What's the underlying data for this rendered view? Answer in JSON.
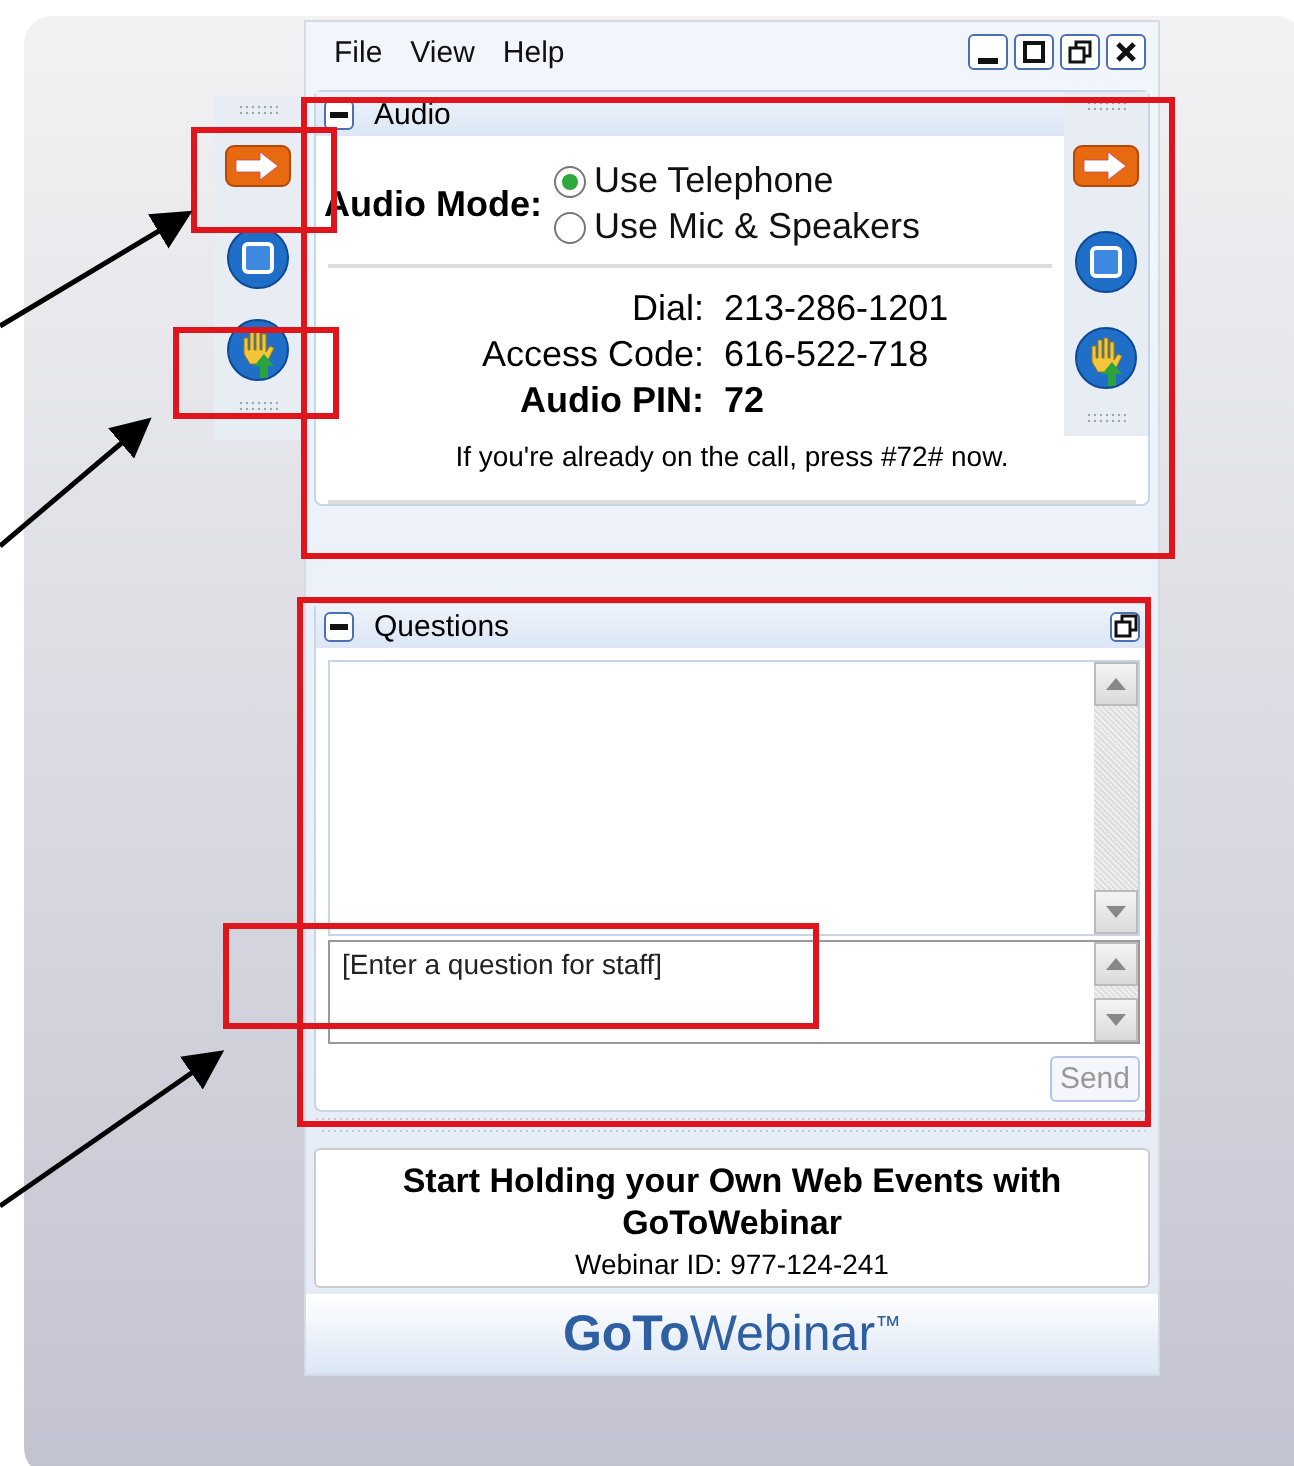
{
  "menu": [
    "File",
    "View",
    "Help"
  ],
  "window_controls": [
    {
      "kind": "minimize"
    },
    {
      "kind": "maximize"
    },
    {
      "kind": "restore"
    },
    {
      "kind": "close"
    }
  ],
  "left_toolbar": [
    {
      "kind": "arrow"
    },
    {
      "kind": "stop"
    },
    {
      "kind": "hand"
    }
  ],
  "audio": {
    "title": "Audio",
    "mode_label": "Audio Mode:",
    "options": [
      {
        "label": "Use Telephone",
        "selected": true
      },
      {
        "label": "Use Mic & Speakers",
        "selected": false
      }
    ],
    "details": [
      {
        "label": "Dial:",
        "value": "213-286-1201",
        "kind": "plain"
      },
      {
        "label": "Access Code:",
        "value": "616-522-718",
        "kind": "plain"
      },
      {
        "label": "Audio PIN:",
        "value": "72",
        "kind": "strong"
      }
    ],
    "note": "If you're already on the call, press #72# now.",
    "toolbar": [
      {
        "kind": "arrow"
      },
      {
        "kind": "stop"
      },
      {
        "kind": "hand"
      }
    ]
  },
  "questions": {
    "title": "Questions",
    "input": {
      "placeholder": "[Enter a question for staff]"
    },
    "send": {
      "label": "Send",
      "disabled": true
    }
  },
  "promo": {
    "title": "Start Holding your Own Web Events with GoToWebinar",
    "webinar_id": "Webinar ID: 977-124-241"
  },
  "logo": {
    "bold": "GoTo",
    "light": "Webinar",
    "mark": "™"
  }
}
